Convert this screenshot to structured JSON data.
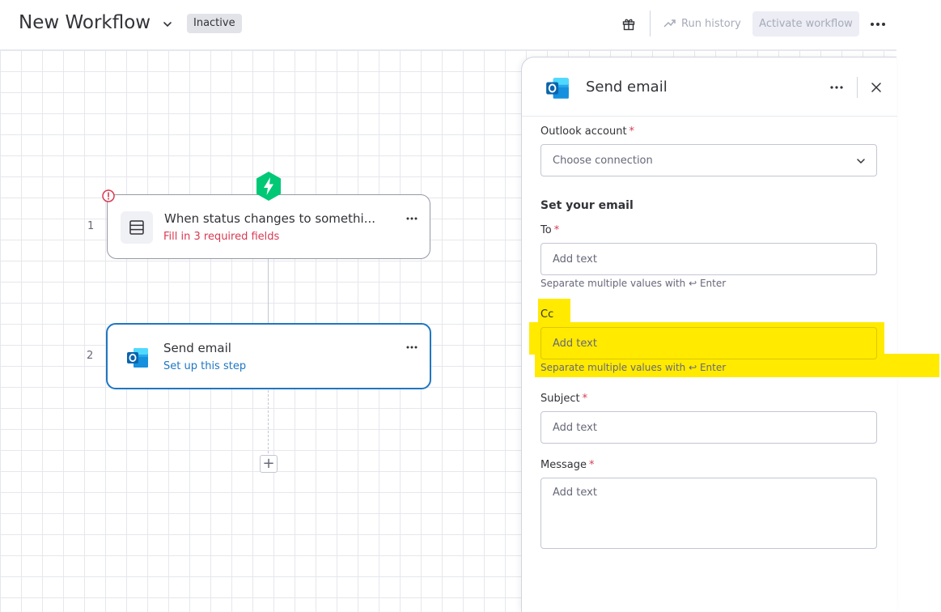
{
  "header": {
    "title": "New Workflow",
    "status": "Inactive",
    "run_history": "Run history",
    "activate": "Activate workflow"
  },
  "canvas": {
    "steps": [
      {
        "number": "1",
        "title": "When status changes to somethi...",
        "subtitle": "Fill in 3 required fields",
        "icon": "board-icon"
      },
      {
        "number": "2",
        "title": "Send email",
        "subtitle": "Set up this step",
        "icon": "outlook-icon"
      }
    ],
    "add_step": "+"
  },
  "panel": {
    "title": "Send email",
    "outlook_account": {
      "label": "Outlook account",
      "required": "*",
      "value": "Choose connection"
    },
    "section_title": "Set your email",
    "to": {
      "label": "To",
      "required": "*",
      "placeholder": "Add text",
      "hint": "Separate multiple values with ↩ Enter"
    },
    "cc": {
      "label": "Cc",
      "placeholder": "Add text",
      "hint": "Separate multiple values with ↩ Enter"
    },
    "subject": {
      "label": "Subject",
      "required": "*",
      "placeholder": "Add text"
    },
    "message": {
      "label": "Message",
      "required": "*",
      "placeholder": "Add text"
    }
  },
  "colors": {
    "accent": "#1f76c2",
    "error": "#d83a52",
    "trigger": "#00c875",
    "highlight": "#ffea00"
  }
}
